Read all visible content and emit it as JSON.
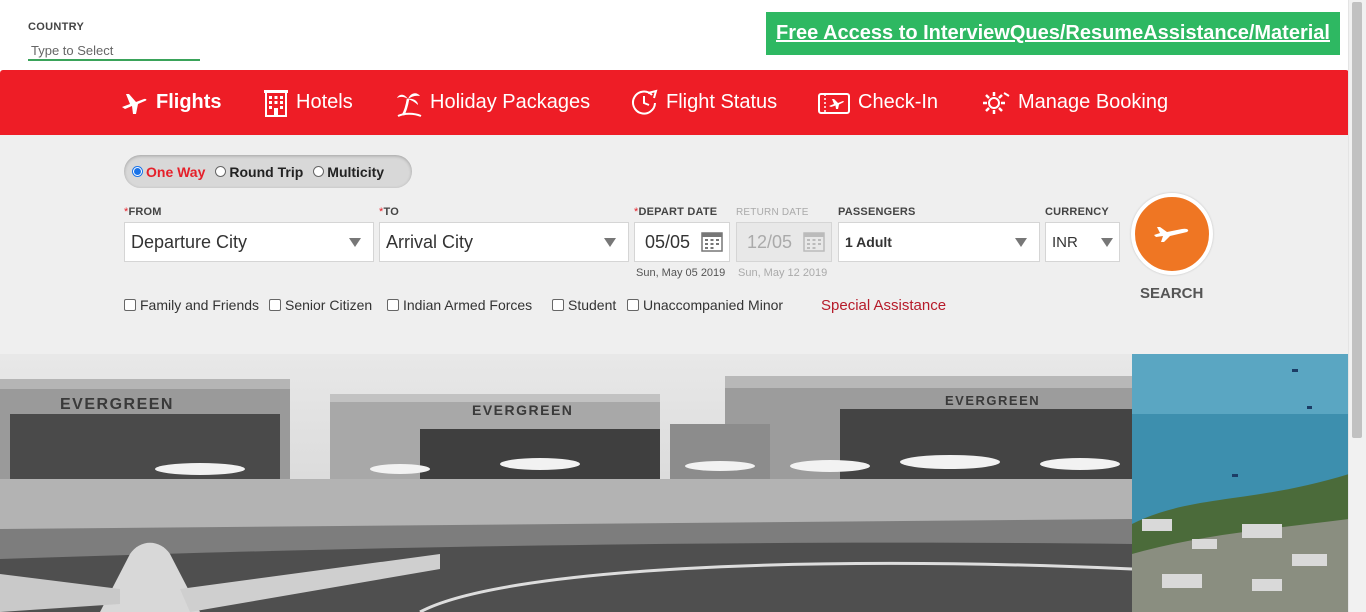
{
  "country": {
    "label": "COUNTRY",
    "placeholder": "Type to Select"
  },
  "promo": {
    "text": "Free Access to InterviewQues/ResumeAssistance/Material"
  },
  "nav": {
    "items": [
      {
        "label": "Flights",
        "icon": "plane-icon",
        "active": true
      },
      {
        "label": "Hotels",
        "icon": "hotel-icon"
      },
      {
        "label": "Holiday Packages",
        "icon": "palm-tree-icon"
      },
      {
        "label": "Flight Status",
        "icon": "clock-plane-icon"
      },
      {
        "label": "Check-In",
        "icon": "boarding-pass-icon"
      },
      {
        "label": "Manage Booking",
        "icon": "gear-icon"
      }
    ]
  },
  "trip": {
    "options": [
      {
        "label": "One Way",
        "checked": true
      },
      {
        "label": "Round Trip",
        "checked": false
      },
      {
        "label": "Multicity",
        "checked": false
      }
    ]
  },
  "form": {
    "from": {
      "label": "FROM",
      "value": "Departure City"
    },
    "to": {
      "label": "TO",
      "value": "Arrival City"
    },
    "depart": {
      "label": "DEPART DATE",
      "value": "05/05",
      "sub": "Sun, May 05 2019"
    },
    "return": {
      "label": "RETURN DATE",
      "value": "12/05",
      "sub": "Sun, May 12 2019"
    },
    "passengers": {
      "label": "PASSENGERS",
      "value": "1 Adult"
    },
    "currency": {
      "label": "CURRENCY",
      "value": "INR"
    },
    "required_mark": "*"
  },
  "search": {
    "label": "SEARCH"
  },
  "concessions": [
    "Family and Friends",
    "Senior Citizen",
    "Indian Armed Forces",
    "Student",
    "Unaccompanied Minor"
  ],
  "special_assistance": "Special Assistance",
  "banner": {
    "signs": [
      "EVERGREEN",
      "EVERGREEN",
      "EVERGREEN"
    ]
  },
  "colors": {
    "brand_red": "#ee1d26",
    "promo_green": "#2eb862",
    "search_orange": "#ef7623",
    "special_link": "#b61b2a"
  }
}
